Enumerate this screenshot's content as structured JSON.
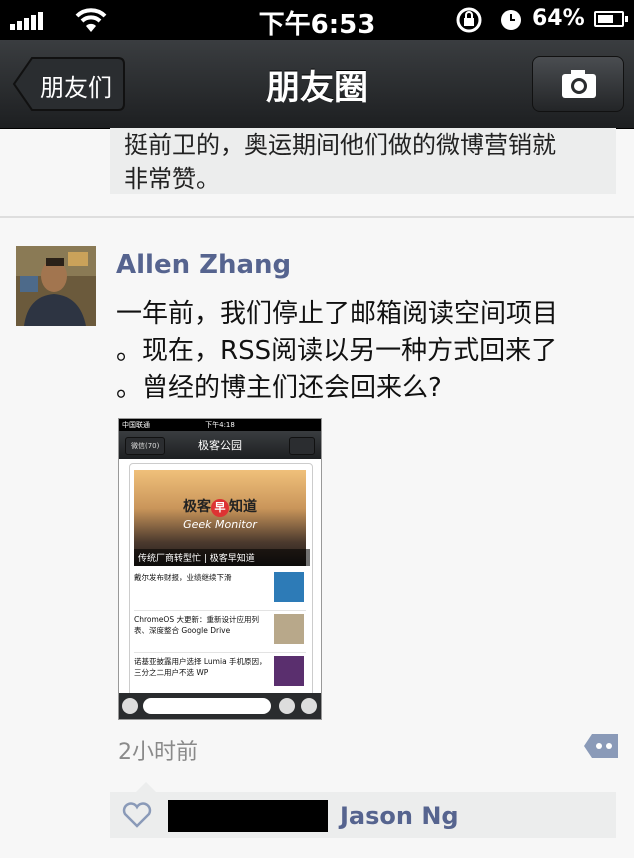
{
  "status_bar": {
    "time": "下午6:53",
    "battery": "64%"
  },
  "nav": {
    "back_label": "朋友们",
    "title": "朋友圈",
    "camera_icon": "camera-icon"
  },
  "previous_post": {
    "text_line1": "挺前卫的，奥运期间他们做的微博营销就",
    "text_line2": "非常赞。"
  },
  "post": {
    "author": "Allen Zhang",
    "content_line1": "一年前，我们停止了邮箱阅读空间项目",
    "content_line2": "。现在，RSS阅读以另一种方式回来了",
    "content_line3": "。曾经的博主们还会回来么?",
    "time": "2小时前",
    "screenshot": {
      "carrier": "中国联通",
      "time": "下午4:18",
      "back": "微信(70)",
      "title": "极客公园",
      "banner_title_a": "极客",
      "banner_title_b": "早",
      "banner_title_c": "知道",
      "banner_sub": "Geek Monitor",
      "banner_caption": "传统厂商转型忙 | 极客早知道",
      "items": [
        {
          "text": "戴尔发布财报，业绩继续下滑"
        },
        {
          "text": "ChromeOS 大更新：重新设计应用列表、深度整合 Google Drive"
        },
        {
          "text": "诺基亚披露用户选择 Lumia 手机原因，三分之二用户不选 WP"
        }
      ]
    }
  },
  "likes": {
    "name": "Jason Ng"
  },
  "colors": {
    "name_blue": "#56648f",
    "navbar_dark": "#1d1f21"
  }
}
